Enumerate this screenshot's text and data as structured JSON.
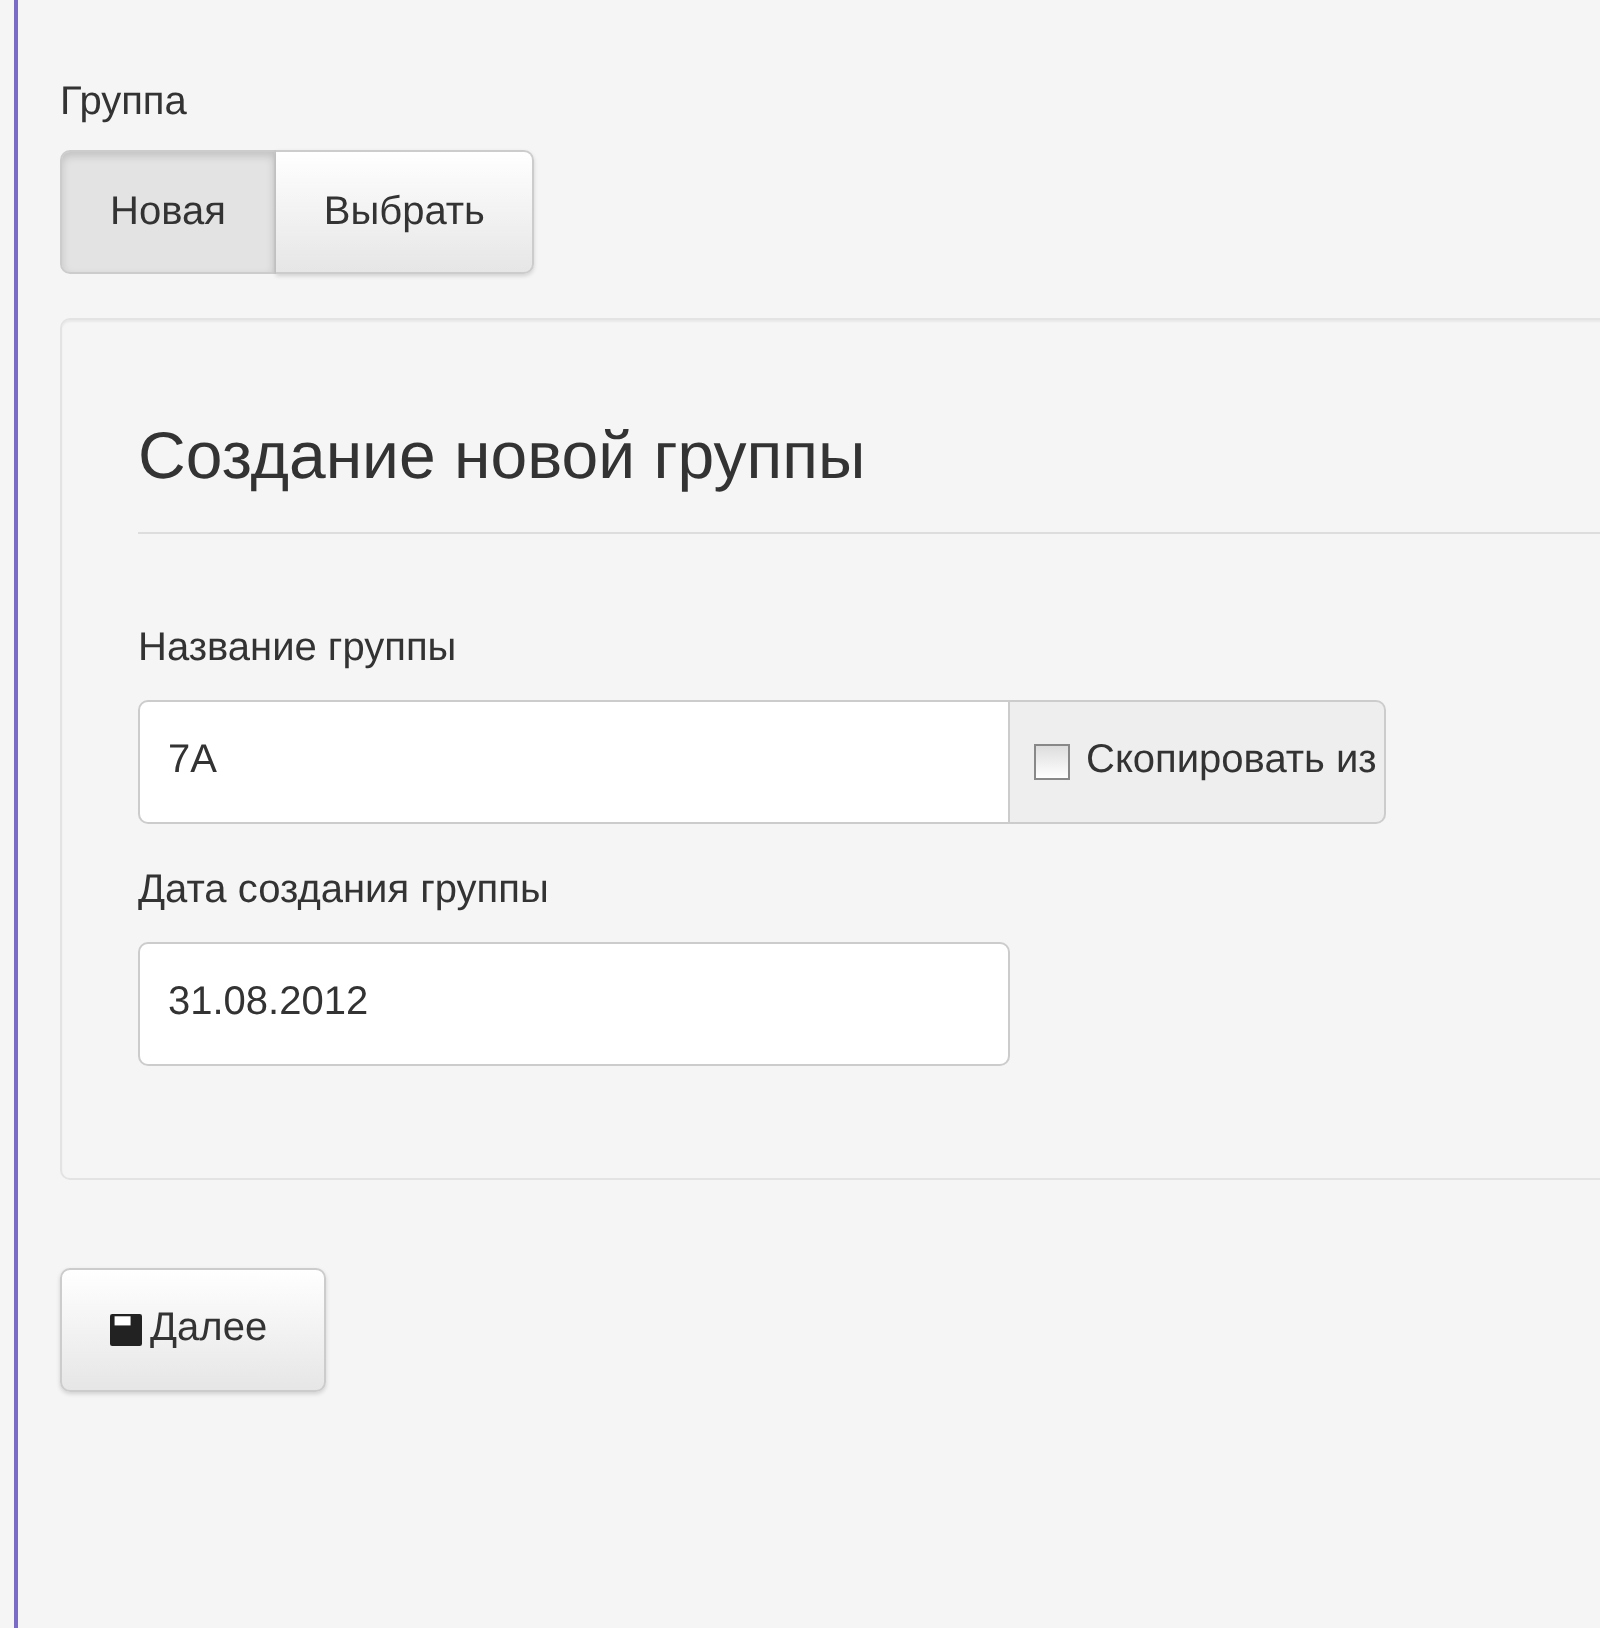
{
  "group_label": "Группа",
  "mode_buttons": [
    {
      "label": "Новая",
      "selected": true
    },
    {
      "label": "Выбрать",
      "selected": false
    }
  ],
  "panel": {
    "title": "Создание новой группы",
    "name_field": {
      "label": "Название группы",
      "value": "7A",
      "addon": {
        "label": "Скопировать из",
        "checked": false
      }
    },
    "date_field": {
      "label": "Дата создания группы",
      "value": "31.08.2012"
    }
  },
  "next_button": {
    "label": "Далее"
  }
}
